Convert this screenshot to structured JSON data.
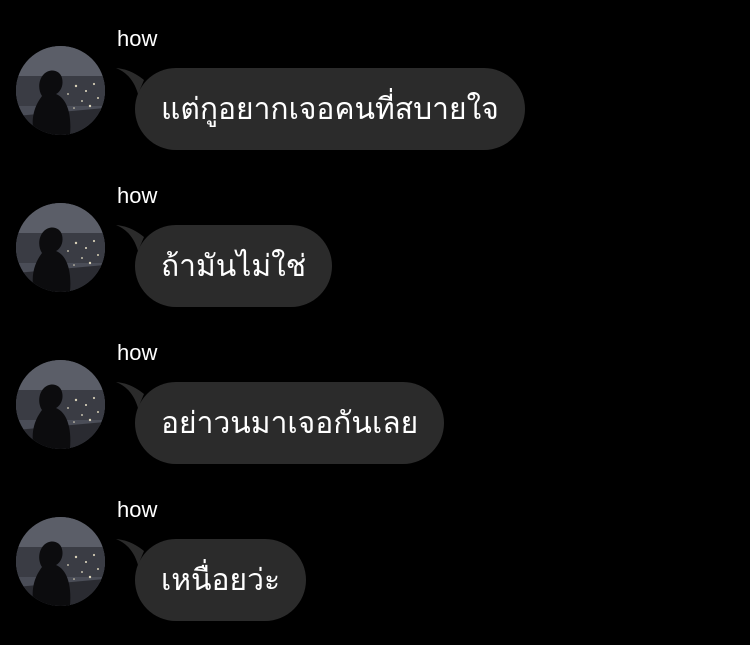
{
  "messages": [
    {
      "sender": "how",
      "text": "แต่กูอยากเจอคนที่สบายใจ",
      "avatar_icon": "profile-photo-silhouette-night-city"
    },
    {
      "sender": "how",
      "text": "ถ้ามันไม่ใช่",
      "avatar_icon": "profile-photo-silhouette-night-city"
    },
    {
      "sender": "how",
      "text": "อย่าวนมาเจอกันเลย",
      "avatar_icon": "profile-photo-silhouette-night-city"
    },
    {
      "sender": "how",
      "text": "เหนื่อยว่ะ",
      "avatar_icon": "profile-photo-silhouette-night-city"
    }
  ],
  "colors": {
    "background": "#000000",
    "bubble": "#2b2b2b",
    "text": "#ffffff"
  }
}
